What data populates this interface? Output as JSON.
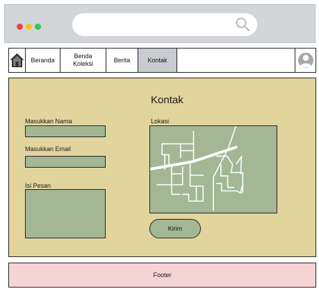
{
  "browser": {
    "window_dots": [
      "red",
      "yellow",
      "green"
    ],
    "search_icon": "search-icon"
  },
  "nav": {
    "home_icon": "home-icon",
    "items": [
      {
        "label": "Beranda"
      },
      {
        "label": "Benda\nKoleksi"
      },
      {
        "label": "Berita"
      },
      {
        "label": "Kontak",
        "active": true
      }
    ],
    "avatar_icon": "user-avatar-icon"
  },
  "contact": {
    "title": "Kontak",
    "name_label": "Masukkan Nama",
    "name_value": "",
    "email_label": "Masukkan Email",
    "email_value": "",
    "message_label": "Isi Pesan",
    "message_value": "",
    "location_label": "Lokasi",
    "submit_label": "Kirim"
  },
  "footer": {
    "text": "Footer"
  },
  "colors": {
    "content_bg": "#e2d49d",
    "field_bg": "#a3b795",
    "footer_bg": "#f5d4d6",
    "active_tab": "#c8cbd0"
  }
}
